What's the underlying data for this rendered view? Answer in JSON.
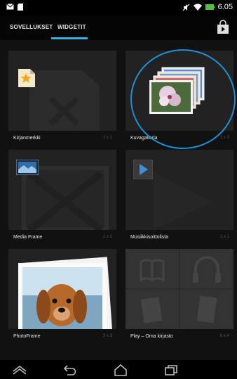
{
  "status_bar": {
    "time": "6.05",
    "left_icons": [
      "email-icon",
      "sd-card-icon"
    ],
    "right_icons": [
      "mute-icon",
      "wifi-icon",
      "battery-icon"
    ]
  },
  "tabs": [
    {
      "label": "SOVELLUKSET",
      "selected": false
    },
    {
      "label": "WIDGETIT",
      "selected": true
    }
  ],
  "accent_color": "#33b5e5",
  "widgets": [
    {
      "label": "Kirjanmerkki",
      "size": "1 x 1",
      "icon": "bookmark-icon"
    },
    {
      "label": "Kuvagalleria",
      "size": "1 x 3",
      "icon": "gallery-icon"
    },
    {
      "label": "Media Frame",
      "size": "1 x 1",
      "icon": "media-frame-icon"
    },
    {
      "label": "Musiikkisoittolista",
      "size": "1 x 1",
      "icon": "play-icon"
    },
    {
      "label": "PhotoFrame",
      "size": "3 x 3",
      "icon": "photo-frame-icon"
    },
    {
      "label": "Play – Oma kirjasto",
      "size": "6 x 4",
      "icon": "play-library-icon"
    }
  ],
  "nav_buttons": [
    "home-up-icon",
    "back-icon",
    "home-icon",
    "recent-apps-icon"
  ]
}
